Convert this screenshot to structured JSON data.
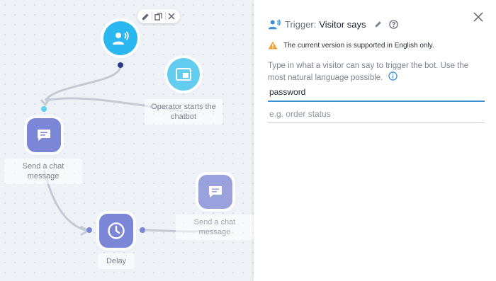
{
  "canvas": {
    "trigger_node": {
      "icon": "visitor-says-icon",
      "color": "#2bb7ef"
    },
    "operator_node": {
      "icon": "chat-window-icon",
      "color": "#62cdef",
      "label": "Operator starts the chatbot"
    },
    "message_node_1": {
      "icon": "chat-message-icon",
      "color": "#7c86d6",
      "label": "Send a chat message"
    },
    "delay_node": {
      "icon": "clock-icon",
      "color": "#7c86d6",
      "label": "Delay"
    },
    "message_node_2": {
      "icon": "chat-message-icon",
      "color": "#9aa2de",
      "label": "Send a chat message"
    },
    "toolbar": {
      "icons": [
        "pencil-icon",
        "duplicate-icon",
        "close-icon"
      ]
    }
  },
  "panel": {
    "header": {
      "label": "Trigger:",
      "value": "Visitor says",
      "icon": "visitor-says-icon"
    },
    "warning": {
      "text": "The current version is supported in English only.",
      "color": "#f0a23a"
    },
    "instructions": "Type in what a visitor can say to trigger the bot. Use the most natural language possible.",
    "phrase_input": {
      "value": "password"
    },
    "new_phrase_input": {
      "placeholder": "e.g. order status"
    },
    "accent": "#3d8fd6"
  }
}
